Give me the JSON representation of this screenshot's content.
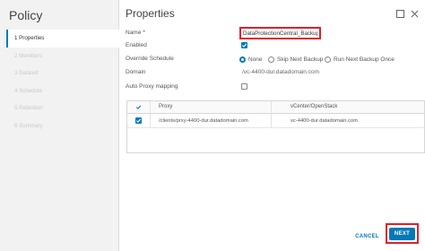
{
  "sidebar": {
    "title": "Policy",
    "steps": [
      {
        "label": "1 Properties"
      },
      {
        "label": "2 Members"
      },
      {
        "label": "3 Dataset"
      },
      {
        "label": "4 Schedule"
      },
      {
        "label": "5 Retention"
      },
      {
        "label": "6 Summary"
      }
    ]
  },
  "main": {
    "heading": "Properties",
    "form": {
      "name_label": "Name",
      "name_required_mark": "*",
      "name_value": "DataProtectionCentral_Backup",
      "enabled_label": "Enabled",
      "enabled_checked": true,
      "override_label": "Override Schedule",
      "override_options": [
        {
          "label": "None",
          "selected": true
        },
        {
          "label": "Skip Next Backup",
          "selected": false
        },
        {
          "label": "Run Next Backup Once",
          "selected": false
        }
      ],
      "domain_label": "Domain",
      "domain_value": "/vc-4400-dur.datadomain.com",
      "auto_proxy_label": "Auto Proxy mapping",
      "auto_proxy_checked": false
    },
    "table": {
      "columns": [
        "Proxy",
        "vCenter/OpenStack"
      ],
      "rows": [
        {
          "checked": true,
          "proxy": "/clients/prxy-4400-dur.datadomain.com",
          "vcenter": "vc-4400-dur.datadomain.com"
        }
      ]
    }
  },
  "footer": {
    "cancel_label": "CANCEL",
    "next_label": "NEXT"
  },
  "colors": {
    "accent": "#0079b8",
    "highlight": "#e0202c"
  },
  "icons": {
    "maximize": "maximize-icon",
    "close": "close-icon",
    "check": "checkmark-icon"
  }
}
